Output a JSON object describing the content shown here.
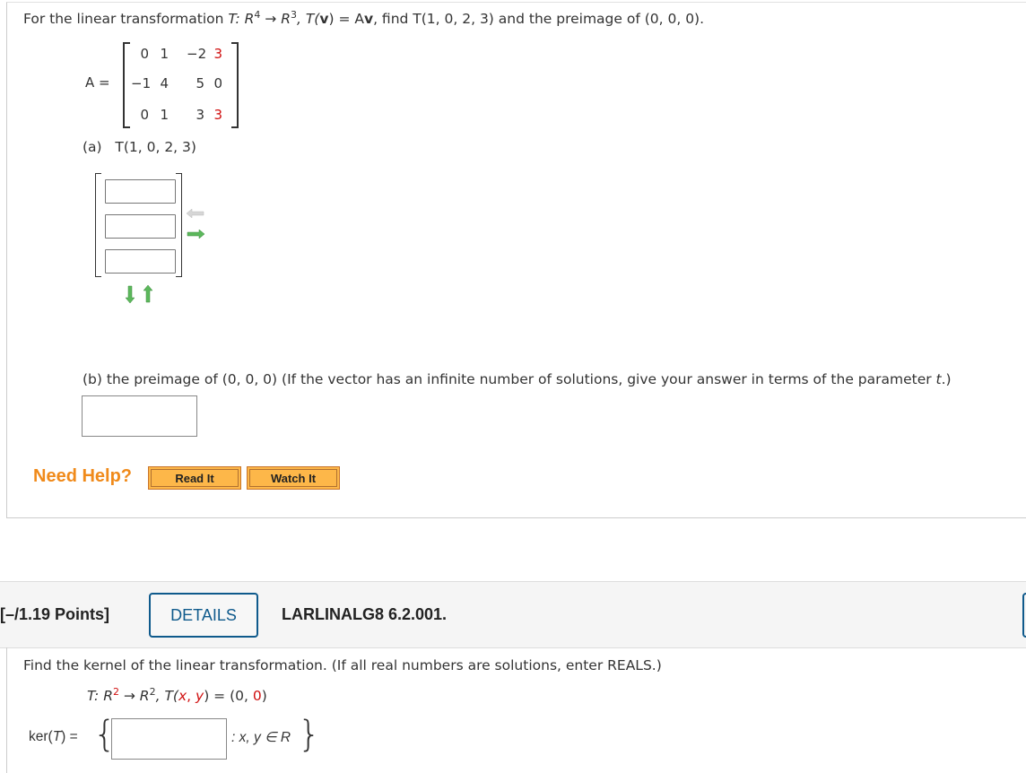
{
  "question1": {
    "prompt": {
      "lead": "For the linear transformation ",
      "T": "T",
      "colon_R": ": R",
      "dom_exp": "4",
      "arrow_R": " → R",
      "cod_exp": "3",
      "Tv_pre": ", T(",
      "v": "v",
      "Tv_post": ") = A",
      "v2": "v",
      "rest": ",  find T(1, 0, 2, 3) and the preimage of (0, 0, 0)."
    },
    "matrix": {
      "label": "A =",
      "rows": [
        [
          "0",
          "1",
          "−2",
          "3"
        ],
        [
          "−1",
          "4",
          "5",
          "0"
        ],
        [
          "0",
          "1",
          "3",
          "3"
        ]
      ],
      "highlight_color": "#d01010"
    },
    "part_a": {
      "label": "(a)",
      "expr": "T(1, 0, 2, 3)",
      "inputs": [
        "",
        "",
        ""
      ],
      "icons": [
        "remove-column-arrow-icon",
        "add-column-arrow-icon",
        "add-row-arrow-icon",
        "remove-row-arrow-icon"
      ]
    },
    "part_b": {
      "text_pre": "(b) the preimage of (0, 0, 0) (If the vector has an infinite number of solutions, give your answer in terms of the parameter ",
      "param": "t",
      "text_post": ".)",
      "input_value": ""
    },
    "help": {
      "label": "Need Help?",
      "read_it": "Read It",
      "watch_it": "Watch It"
    }
  },
  "question2": {
    "points": "[–/1.19 Points]",
    "details_label": "DETAILS",
    "code": "LARLINALG8 6.2.001.",
    "prompt": "Find the kernel of the linear transformation. (If all real numbers are solutions, enter REALS.)",
    "transform": {
      "T": "T",
      "colon_R": ": R",
      "exp1": "2",
      "arrow_R": " → R",
      "exp2": "2",
      "Tpre": ", T(",
      "x": "x",
      "comma": ", ",
      "y": "y",
      "eq": ") = (",
      "zero1": "0",
      "sep": ", ",
      "zero2": "0",
      "close": ")"
    },
    "kernel": {
      "label_pre": "ker(",
      "T": "T",
      "label_post": ") =",
      "input_value": "",
      "tail": ": x, y ∈ R"
    }
  },
  "colors": {
    "accent_blue": "#0f5a8c",
    "help_orange": "#f08a1a",
    "button_fill": "#fdb749",
    "red_text": "#d01010"
  }
}
